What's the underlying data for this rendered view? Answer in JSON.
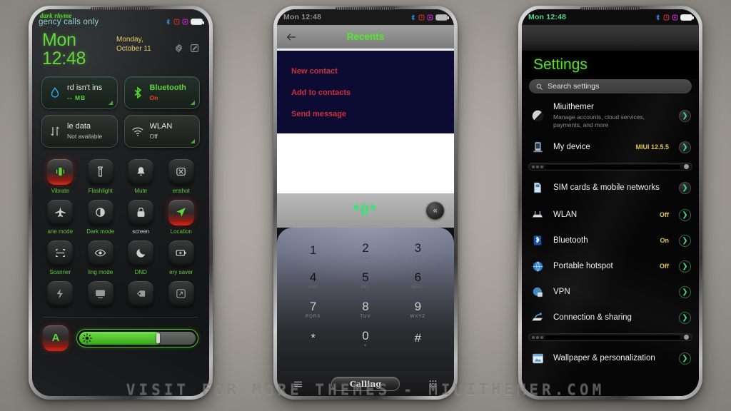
{
  "watermark": "VISIT FOR MORE THEMES - MIUITHEMER.COM",
  "theme_name": "dark rhyme",
  "status_bar": {
    "time": "Mon 12:48",
    "carrier_text": "gency calls only",
    "icons": [
      "bluetooth-icon",
      "alarm-icon",
      "screenshot-icon",
      "battery-icon"
    ]
  },
  "control_center": {
    "clock": "Mon 12:48",
    "date": "Monday, October 11",
    "actions": [
      "settings-gear-icon",
      "edit-icon"
    ],
    "big_tiles": [
      {
        "title": "rd isn't ins",
        "status": "-- MB",
        "icon": "water-drop-icon",
        "state": "on"
      },
      {
        "title": "Bluetooth",
        "status": "On",
        "icon": "bluetooth-icon",
        "state": "on"
      },
      {
        "title": "le data",
        "status": "Not available",
        "icon": "data-transfer-icon",
        "state": "off"
      },
      {
        "title": "WLAN",
        "status": "Off",
        "icon": "wifi-icon",
        "state": "off"
      }
    ],
    "toggles": [
      {
        "label": "Vibrate",
        "icon": "vibrate-icon",
        "on": true
      },
      {
        "label": "Flashlight",
        "icon": "flashlight-icon",
        "on": false
      },
      {
        "label": "Mute",
        "icon": "bell-icon",
        "on": false
      },
      {
        "label": "enshot",
        "icon": "screenshot-icon",
        "on": false
      },
      {
        "label": "ane mode",
        "icon": "airplane-icon",
        "on": false
      },
      {
        "label": "Dark mode",
        "icon": "contrast-icon",
        "on": false
      },
      {
        "label": "screen",
        "icon": "lock-icon",
        "on": false
      },
      {
        "label": "Location",
        "icon": "location-arrow-icon",
        "on": true
      },
      {
        "label": "Scanner",
        "icon": "scan-frame-icon",
        "on": false
      },
      {
        "label": "ling mode",
        "icon": "eye-icon",
        "on": false
      },
      {
        "label": "DND",
        "icon": "moon-icon",
        "on": false
      },
      {
        "label": "ery saver",
        "icon": "battery-plus-icon",
        "on": false
      },
      {
        "label": "",
        "icon": "lightning-icon",
        "on": false
      },
      {
        "label": "",
        "icon": "cast-icon",
        "on": false
      },
      {
        "label": "",
        "icon": "nfc-icon",
        "on": false
      },
      {
        "label": "",
        "icon": "rotate-icon",
        "on": false
      }
    ],
    "brightness": {
      "auto_label": "A",
      "value": 68,
      "icon": "brightness-gear-icon"
    }
  },
  "dialer": {
    "status_time": "Mon 12:48",
    "appbar_title": "Recents",
    "back_icon": "back-arrow-icon",
    "menu_items": [
      "New contact",
      "Add to contacts",
      "Send message"
    ],
    "dialed_number": "*0*",
    "backspace_icon": "backspace-icon",
    "keys": [
      {
        "num": "1",
        "sub": ""
      },
      {
        "num": "2",
        "sub": "ABC"
      },
      {
        "num": "3",
        "sub": "DEF"
      },
      {
        "num": "4",
        "sub": "GHI"
      },
      {
        "num": "5",
        "sub": "JKL"
      },
      {
        "num": "6",
        "sub": "MNO"
      },
      {
        "num": "7",
        "sub": "PQRS"
      },
      {
        "num": "8",
        "sub": "TUV"
      },
      {
        "num": "9",
        "sub": "WXYZ"
      },
      {
        "num": "*",
        "sub": ""
      },
      {
        "num": "0",
        "sub": "+"
      },
      {
        "num": "#",
        "sub": ""
      }
    ],
    "call_button_label": "Calling",
    "left_icon": "menu-lines-icon",
    "right_icon": "keypad-grid-icon"
  },
  "settings": {
    "status_time": "Mon 12:48",
    "title": "Settings",
    "search_placeholder": "Search settings",
    "search_icon": "search-icon",
    "rows": [
      {
        "label": "Miuithemer",
        "sub": "Manage accounts, cloud services, payments, and more",
        "value": "",
        "icon": "account-avatar-icon"
      },
      {
        "label": "My device",
        "sub": "",
        "value": "MIUI 12.5.5",
        "icon": "phone-device-icon"
      },
      {
        "label": "SIM cards & mobile networks",
        "sub": "",
        "value": "",
        "icon": "sim-card-icon"
      },
      {
        "label": "WLAN",
        "sub": "",
        "value": "Off",
        "icon": "router-icon"
      },
      {
        "label": "Bluetooth",
        "sub": "",
        "value": "On",
        "icon": "bluetooth-icon"
      },
      {
        "label": "Portable hotspot",
        "sub": "",
        "value": "Off",
        "icon": "hotspot-globe-icon"
      },
      {
        "label": "VPN",
        "sub": "",
        "value": "",
        "icon": "vpn-lock-icon"
      },
      {
        "label": "Connection & sharing",
        "sub": "",
        "value": "",
        "icon": "sharing-icon"
      },
      {
        "label": "Wallpaper & personalization",
        "sub": "",
        "value": "",
        "icon": "wallpaper-icon"
      }
    ]
  },
  "colors": {
    "accent_green": "#63d63c",
    "accent_red": "#d52a1c",
    "accent_yellow": "#e3c64a",
    "menu_bg": "#0b0b33",
    "menu_text": "#d02f3c"
  }
}
